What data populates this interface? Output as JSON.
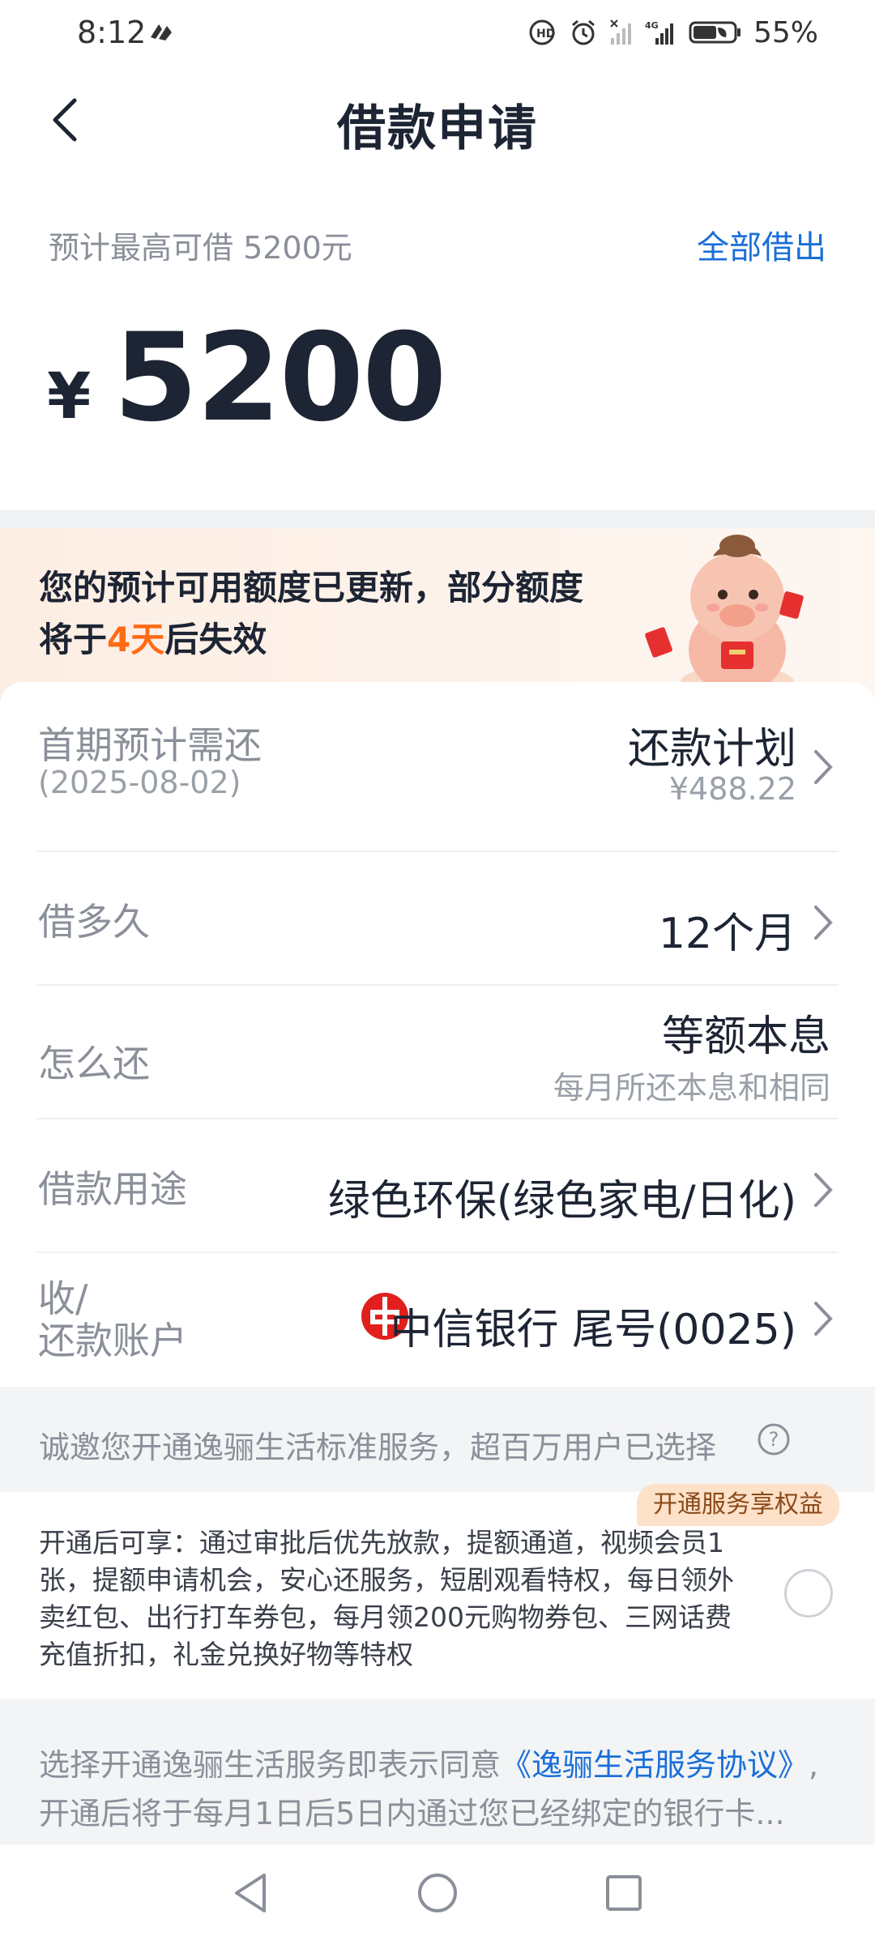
{
  "status_bar": {
    "time": "8:12",
    "battery_percent": "55%",
    "icons": [
      "network-speed-icon",
      "volte-icon",
      "alarm-icon",
      "no-signal-icon",
      "4g-signal-icon",
      "battery-icon"
    ]
  },
  "header": {
    "title": "借款申请"
  },
  "amount": {
    "max_hint": "预计最高可借 5200元",
    "borrow_all": "全部借出",
    "currency": "¥",
    "value": "5200"
  },
  "banner": {
    "text_before": "您的预计可用额度已更新，部分额度将于",
    "highlight": "4天",
    "text_after": "后失效"
  },
  "rows": {
    "first_payment": {
      "label": "首期预计需还",
      "date": "(2025-08-02)",
      "value": "还款计划",
      "amount": "¥488.22"
    },
    "term": {
      "label": "借多久",
      "value": "12个月"
    },
    "repay_method": {
      "label": "怎么还",
      "value": "等额本息",
      "desc": "每月所还本息和相同"
    },
    "purpose": {
      "label": "借款用途",
      "value": "绿色环保(绿色家电/日化)"
    },
    "account": {
      "label_line1": "收/",
      "label_line2": "还款账户",
      "value": "中信银行 尾号(0025)"
    }
  },
  "service": {
    "invite": "诚邀您开通逸骊生活标准服务，超百万用户已选择",
    "badge": "开通服务享权益",
    "description": "开通后可享：通过审批后优先放款，提额通道，视频会员1张，提额申请机会，安心还服务，短剧观看特权，每日领外卖红包、出行打车券包，每月领200元购物券包、三网话费充值折扣，礼金兑换好物等特权",
    "selected": false
  },
  "agreement": {
    "prefix": "选择开通逸骊生活服务即表示同意",
    "link": "《逸骊生活服务协议》",
    "suffix": ",开通后将于每月1日后5日内通过您已经绑定的银行卡..."
  },
  "colors": {
    "accent": "#1a6fd8",
    "highlight": "#ff6a14",
    "text_primary": "#1d2433",
    "text_secondary": "#8a8f99",
    "banner_bg": "#fdeee3",
    "badge_bg": "#fde1c8"
  }
}
